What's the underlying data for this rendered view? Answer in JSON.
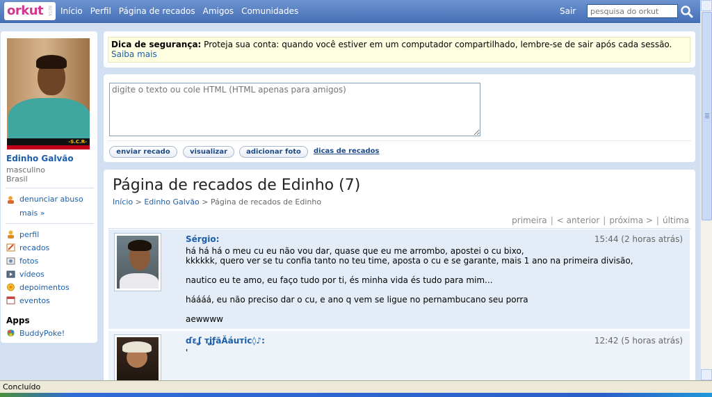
{
  "topbar": {
    "logo": "orkut",
    "logo_beta": "BETA",
    "nav": [
      "Início",
      "Perfil",
      "Página de recados",
      "Amigos",
      "Comunidades"
    ],
    "sair": "Sair",
    "search_placeholder": "pesquisa do orkut",
    "search_icon": "search-icon"
  },
  "profile": {
    "name": "Edinho Galvão",
    "gender": "masculino",
    "country": "Brasil",
    "photo_caption": "-S.C.R-",
    "actions": [
      {
        "label": "denunciar abuso",
        "icon": "report-icon"
      },
      {
        "label": "mais »",
        "icon": ""
      }
    ],
    "menu": [
      {
        "label": "perfil",
        "icon": "profile-icon"
      },
      {
        "label": "recados",
        "icon": "scraps-icon"
      },
      {
        "label": "fotos",
        "icon": "photos-icon"
      },
      {
        "label": "vídeos",
        "icon": "videos-icon"
      },
      {
        "label": "depoimentos",
        "icon": "testimonials-icon"
      },
      {
        "label": "eventos",
        "icon": "events-icon"
      }
    ],
    "apps_title": "Apps",
    "apps": [
      {
        "label": "BuddyPoke!",
        "icon": "buddypoke-icon"
      }
    ]
  },
  "tip": {
    "bold": "Dica de segurança:",
    "text": " Proteja sua conta: quando você estiver em um computador compartilhado, lembre-se de sair após cada sessão. ",
    "link": "Saiba mais"
  },
  "compose": {
    "placeholder": "digite o texto ou cole HTML (HTML apenas para amigos)",
    "buttons": [
      "enviar recado",
      "visualizar",
      "adicionar foto"
    ],
    "tips_link": "dicas de recados"
  },
  "scrapbook": {
    "title": "Página de recados de Edinho (7)",
    "breadcrumb": [
      "Início",
      "Edinho Galvão",
      "Página de recados de Edinho"
    ],
    "pager": [
      "primeira",
      "< anterior",
      "próxima >",
      "última"
    ],
    "scraps": [
      {
        "author": "Sérgio:",
        "time": "15:44 (2 horas atrás)",
        "lines": [
          "há há há o meu cu eu não vou dar, quase que eu me arrombo, apostei o cu bixo,",
          "kkkkkk, quero ver se tu confia tanto no teu time, aposta o cu e se garante, mais 1 ano na primeira divisão,",
          "",
          "nautico eu te amo, eu faço tudo por ti, és minha vida és tudo para mim...",
          "",
          "háááá, eu não preciso dar o cu, e ano q vem se ligue no pernambucano seu porra",
          "",
          "aewwww"
        ]
      },
      {
        "author": "ɗɛʆ тʝƒãӐáuтic◊♪:",
        "time": "12:42 (5 horas atrás)",
        "lines": [
          "'"
        ]
      }
    ]
  },
  "statusbar": {
    "text": "Concluído"
  }
}
